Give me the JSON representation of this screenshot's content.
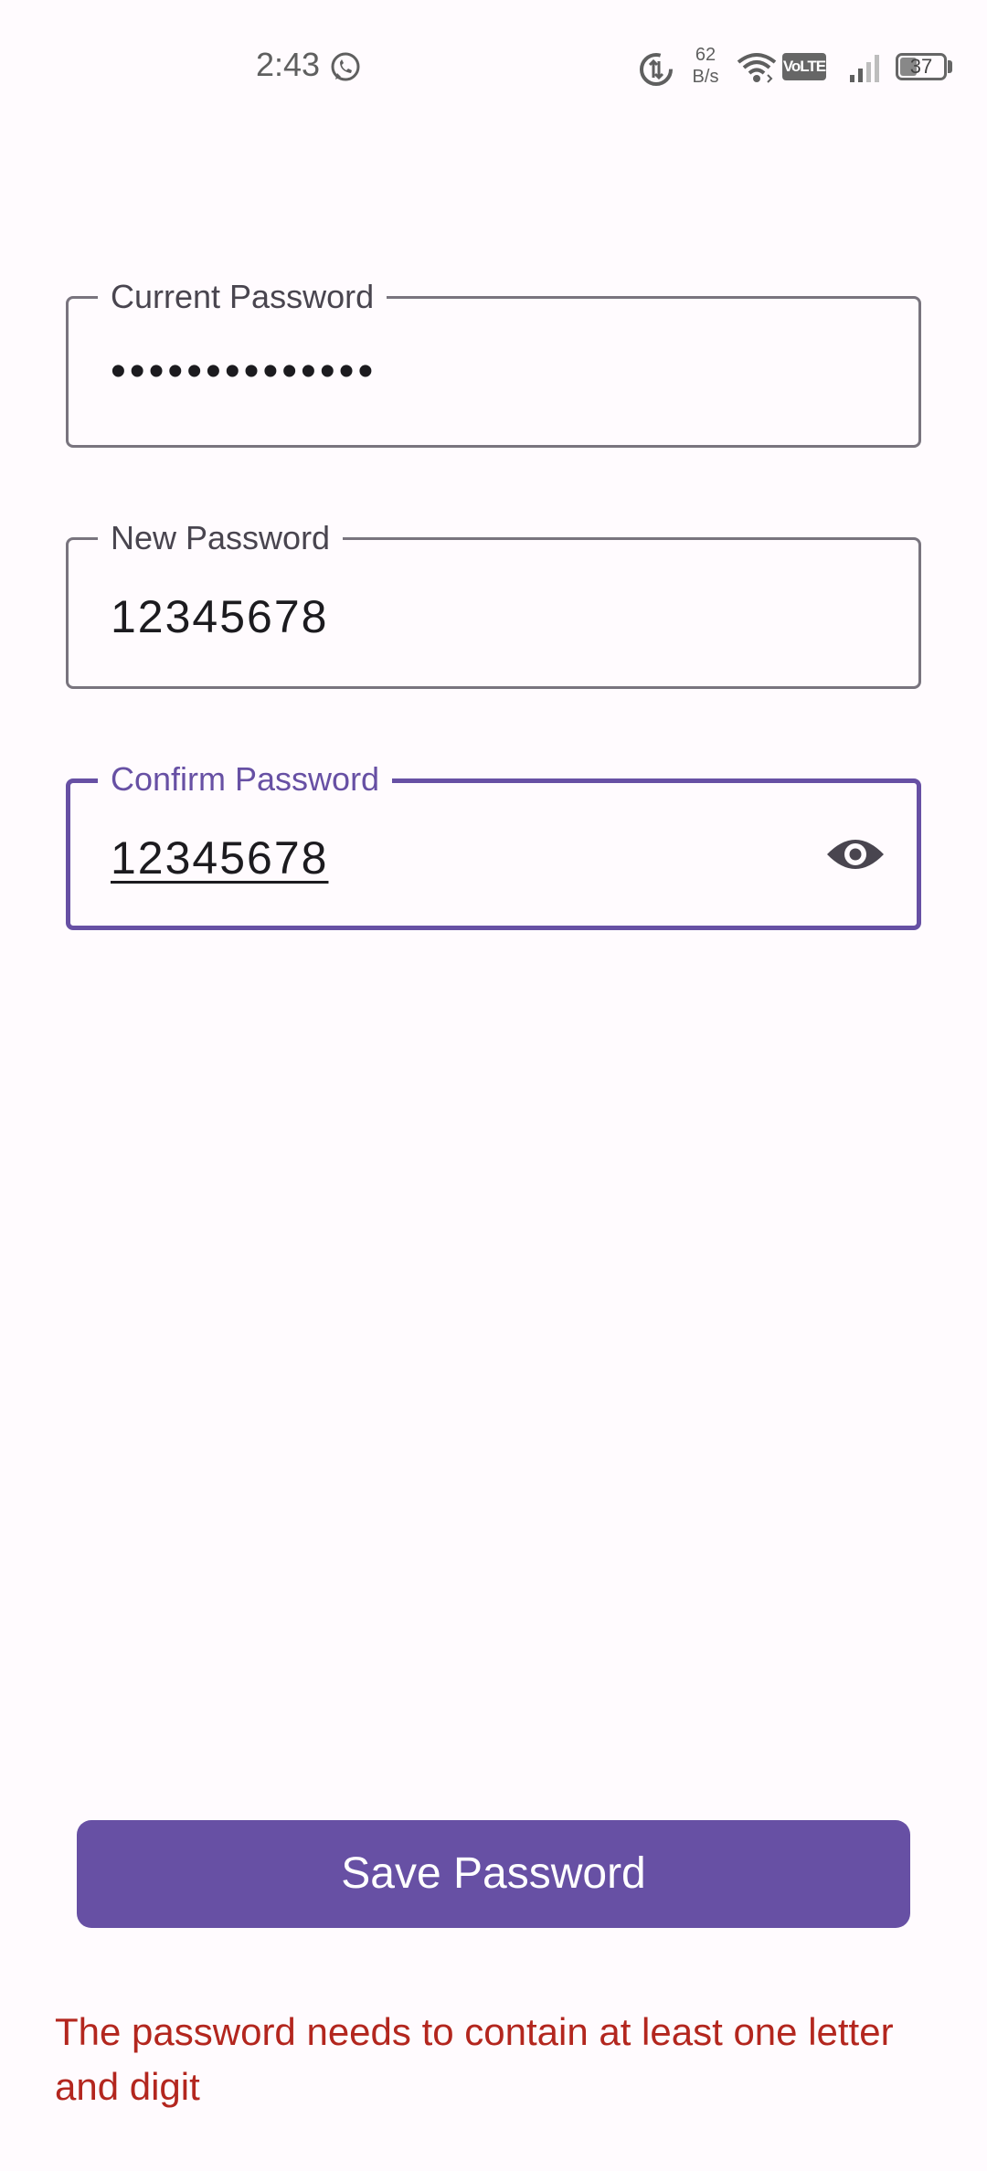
{
  "status_bar": {
    "time": "2:43",
    "net_speed_value": "62",
    "net_speed_unit": "B/s",
    "volte": "VoLTE",
    "battery": "37",
    "icons": [
      "whatsapp-icon",
      "data-saver-icon",
      "wifi-icon",
      "signal-icon",
      "battery-icon"
    ]
  },
  "form": {
    "current_password": {
      "label": "Current Password",
      "value": "••••••••••••••"
    },
    "new_password": {
      "label": "New Password",
      "value": "12345678"
    },
    "confirm_password": {
      "label": "Confirm Password",
      "value": "12345678",
      "trailing_icon": "eye-icon"
    }
  },
  "actions": {
    "save_label": "Save Password"
  },
  "error": {
    "message": "The password needs to contain at least one letter and digit"
  },
  "colors": {
    "primary": "#6750a4",
    "background": "#fffbfe",
    "outline": "#79747e",
    "error": "#b3261e"
  }
}
